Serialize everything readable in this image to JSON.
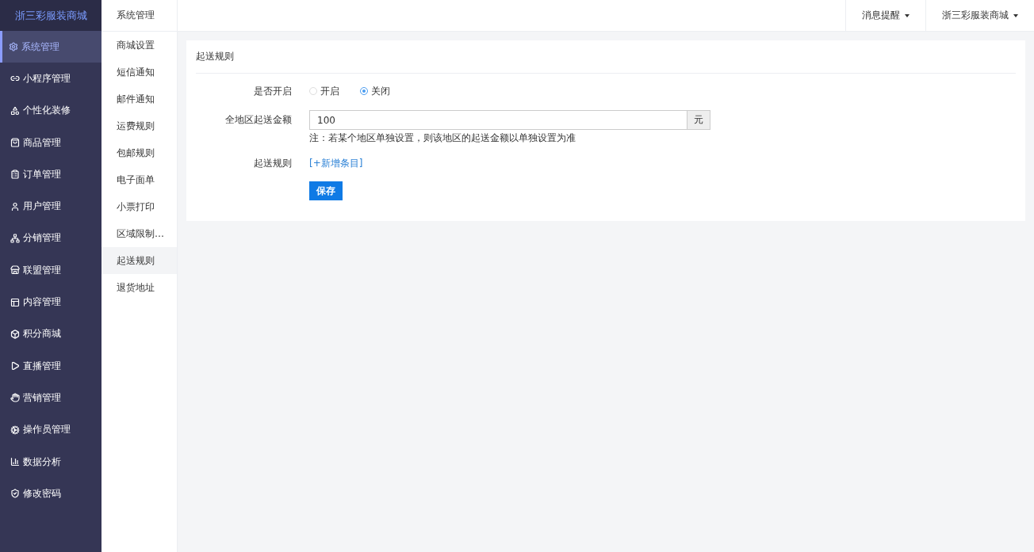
{
  "brand": "浙三彩服装商城",
  "main_menu": [
    {
      "label": "系统管理",
      "selected": true
    },
    {
      "label": "小程序管理",
      "selected": false
    },
    {
      "label": "个性化装修",
      "selected": false
    },
    {
      "label": "商品管理",
      "selected": false
    },
    {
      "label": "订单管理",
      "selected": false
    },
    {
      "label": "用户管理",
      "selected": false
    },
    {
      "label": "分销管理",
      "selected": false
    },
    {
      "label": "联盟管理",
      "selected": false
    },
    {
      "label": "内容管理",
      "selected": false
    },
    {
      "label": "积分商城",
      "selected": false
    },
    {
      "label": "直播管理",
      "selected": false
    },
    {
      "label": "营销管理",
      "selected": false
    },
    {
      "label": "操作员管理",
      "selected": false
    },
    {
      "label": "数据分析",
      "selected": false
    },
    {
      "label": "修改密码",
      "selected": false
    }
  ],
  "sub_menu": {
    "title": "系统管理",
    "items": [
      {
        "label": "商城设置",
        "selected": false
      },
      {
        "label": "短信通知",
        "selected": false
      },
      {
        "label": "邮件通知",
        "selected": false
      },
      {
        "label": "运费规则",
        "selected": false
      },
      {
        "label": "包邮规则",
        "selected": false
      },
      {
        "label": "电子面单",
        "selected": false
      },
      {
        "label": "小票打印",
        "selected": false
      },
      {
        "label": "区域限制…",
        "selected": false
      },
      {
        "label": "起送规则",
        "selected": true
      },
      {
        "label": "退货地址",
        "selected": false
      }
    ]
  },
  "top_bar": {
    "menus": [
      "消息提醒",
      "浙三彩服装商城"
    ]
  },
  "panel": {
    "title": "起送规则",
    "enable": {
      "label": "是否开启",
      "options": [
        {
          "label": "开启",
          "selected": false
        },
        {
          "label": "关闭",
          "selected": true
        }
      ]
    },
    "amount": {
      "label": "全地区起送金额",
      "value": "100",
      "unit": "元",
      "note": "注：若某个地区单独设置，则该地区的起送金额以单独设置为准"
    },
    "rules": {
      "label": "起送规则",
      "link": "[+新增条目]"
    },
    "save": "保存"
  }
}
